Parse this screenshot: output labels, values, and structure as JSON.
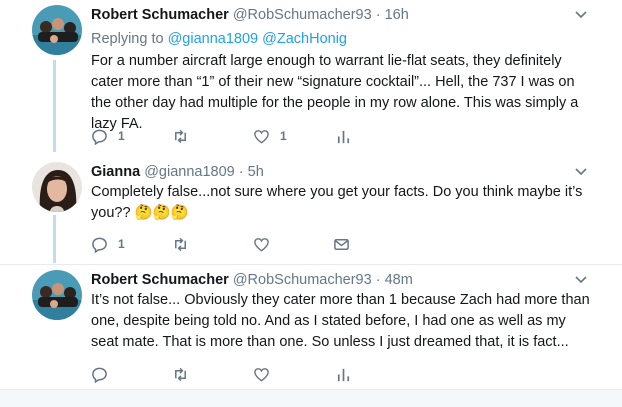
{
  "tweets": [
    {
      "name": "Robert Schumacher",
      "handle": "@RobSchumacher93",
      "time": "16h",
      "replying_label": "Replying to",
      "replying_to": [
        "@gianna1809",
        "@ZachHonig"
      ],
      "text": "For a number aircraft large enough to warrant lie-flat seats, they definitely cater more than “1” of their new “signature cocktail”...  Hell, the 737 I was on the other day had multiple for the people in my row alone.  This was simply a lazy FA.",
      "reply_count": "1",
      "retweet_count": "",
      "like_count": "1",
      "fourth_action": "analytics-icon"
    },
    {
      "name": "Gianna",
      "handle": "@gianna1809",
      "time": "5h",
      "text": "Completely false...not sure where you get your facts. Do you think maybe it’s you??",
      "emoji": "🤔🤔🤔",
      "reply_count": "1",
      "retweet_count": "",
      "like_count": "",
      "fourth_action": "envelope-icon"
    },
    {
      "name": "Robert Schumacher",
      "handle": "@RobSchumacher93",
      "time": "48m",
      "text": "It’s not false...  Obviously they cater more than 1 because Zach had more than one, despite being told no.  And as I stated before, I had one as well as my seat mate.  That is more than one.  So unless I just dreamed that, it is fact...",
      "reply_count": "",
      "retweet_count": "",
      "like_count": "",
      "fourth_action": "analytics-icon"
    }
  ],
  "separator": "·",
  "colors": {
    "icon": "#657786",
    "link": "#1da1f2",
    "thread_line": "#c4dbeb",
    "divider": "#e6ecf0"
  }
}
